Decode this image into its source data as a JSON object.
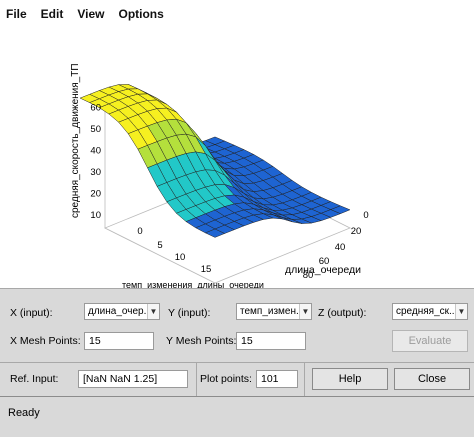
{
  "menu": {
    "items": [
      "File",
      "Edit",
      "View",
      "Options"
    ]
  },
  "plot": {
    "z_axis_label": "средняя_скорость_движения_ТП",
    "x_axis_label": "длина_очереди",
    "y_axis_label": "темп_изменения_длины_очереди",
    "z_ticks": [
      "10",
      "20",
      "30",
      "40",
      "50",
      "60"
    ],
    "x_ticks": [
      "0",
      "20",
      "40",
      "60",
      "80"
    ],
    "y_ticks": [
      "0",
      "5",
      "10",
      "15"
    ],
    "colors": {
      "low": "#1e64d2",
      "mid": "#22c8c8",
      "high": "#b4e03c",
      "top": "#f6f020",
      "edge": "#222222"
    }
  },
  "controls": {
    "x_label": "X (input):",
    "x_value": "длина_очер...",
    "y_label": "Y (input):",
    "y_value": "темп_измен...",
    "z_label": "Z (output):",
    "z_value": "средняя_ск...",
    "x_mesh_label": "X Mesh Points:",
    "x_mesh_value": "15",
    "y_mesh_label": "Y Mesh Points:",
    "y_mesh_value": "15",
    "evaluate_label": "Evaluate",
    "ref_input_label": "Ref. Input:",
    "ref_input_value": "[NaN NaN 1.25]",
    "plot_points_label": "Plot points:",
    "plot_points_value": "101",
    "help_label": "Help",
    "close_label": "Close"
  },
  "status": {
    "text": "Ready"
  }
}
